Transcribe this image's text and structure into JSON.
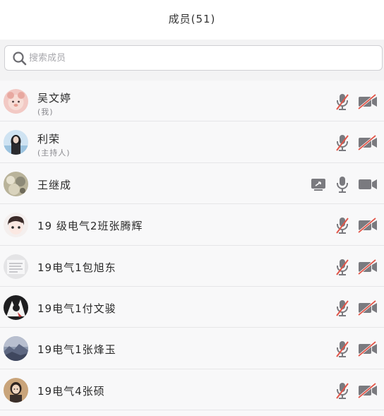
{
  "header": {
    "title": "成员(51)"
  },
  "search": {
    "placeholder": "搜索成员"
  },
  "members": [
    {
      "name": "吴文婷",
      "role": "(我)",
      "mic": "muted",
      "camera": "off",
      "sharing": false
    },
    {
      "name": "利荣",
      "role": "(主持人)",
      "mic": "muted",
      "camera": "off",
      "sharing": false
    },
    {
      "name": "王继成",
      "role": "",
      "mic": "on",
      "camera": "on",
      "sharing": true
    },
    {
      "name": "19 级电气2班张腾辉",
      "role": "",
      "mic": "muted",
      "camera": "off",
      "sharing": false
    },
    {
      "name": "19电气1包旭东",
      "role": "",
      "mic": "muted",
      "camera": "off",
      "sharing": false
    },
    {
      "name": "19电气1付文骏",
      "role": "",
      "mic": "muted",
      "camera": "off",
      "sharing": false
    },
    {
      "name": "19电气1张烽玉",
      "role": "",
      "mic": "muted",
      "camera": "off",
      "sharing": false
    },
    {
      "name": "19电气4张硕",
      "role": "",
      "mic": "muted",
      "camera": "off",
      "sharing": false
    }
  ],
  "colors": {
    "muted_slash": "#e0564a",
    "icon_gray": "#7a7a7f",
    "background": "#f8f8f9"
  }
}
